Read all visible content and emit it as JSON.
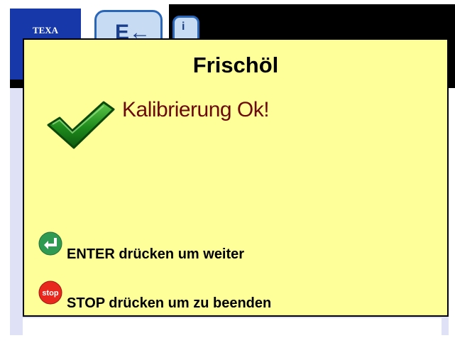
{
  "background": {
    "logo_text": "TEXA",
    "app_button_glyph": "E←",
    "info_button_glyph": "i",
    "colors": {
      "logo": "#1638a8",
      "panel": "#dfe1f7",
      "topbar": "#000000"
    }
  },
  "dialog": {
    "title": "Frischöl",
    "message": "Kalibrierung Ok!",
    "status_icon": "checkmark-icon",
    "background_color": "#ffff99",
    "message_color": "#6b0a0a",
    "hints": {
      "enter": {
        "icon": "enter-icon",
        "label": "ENTER drücken um weiter"
      },
      "stop": {
        "icon": "stop-icon",
        "icon_text": "stop",
        "label": "STOP drücken um zu beenden"
      }
    }
  }
}
